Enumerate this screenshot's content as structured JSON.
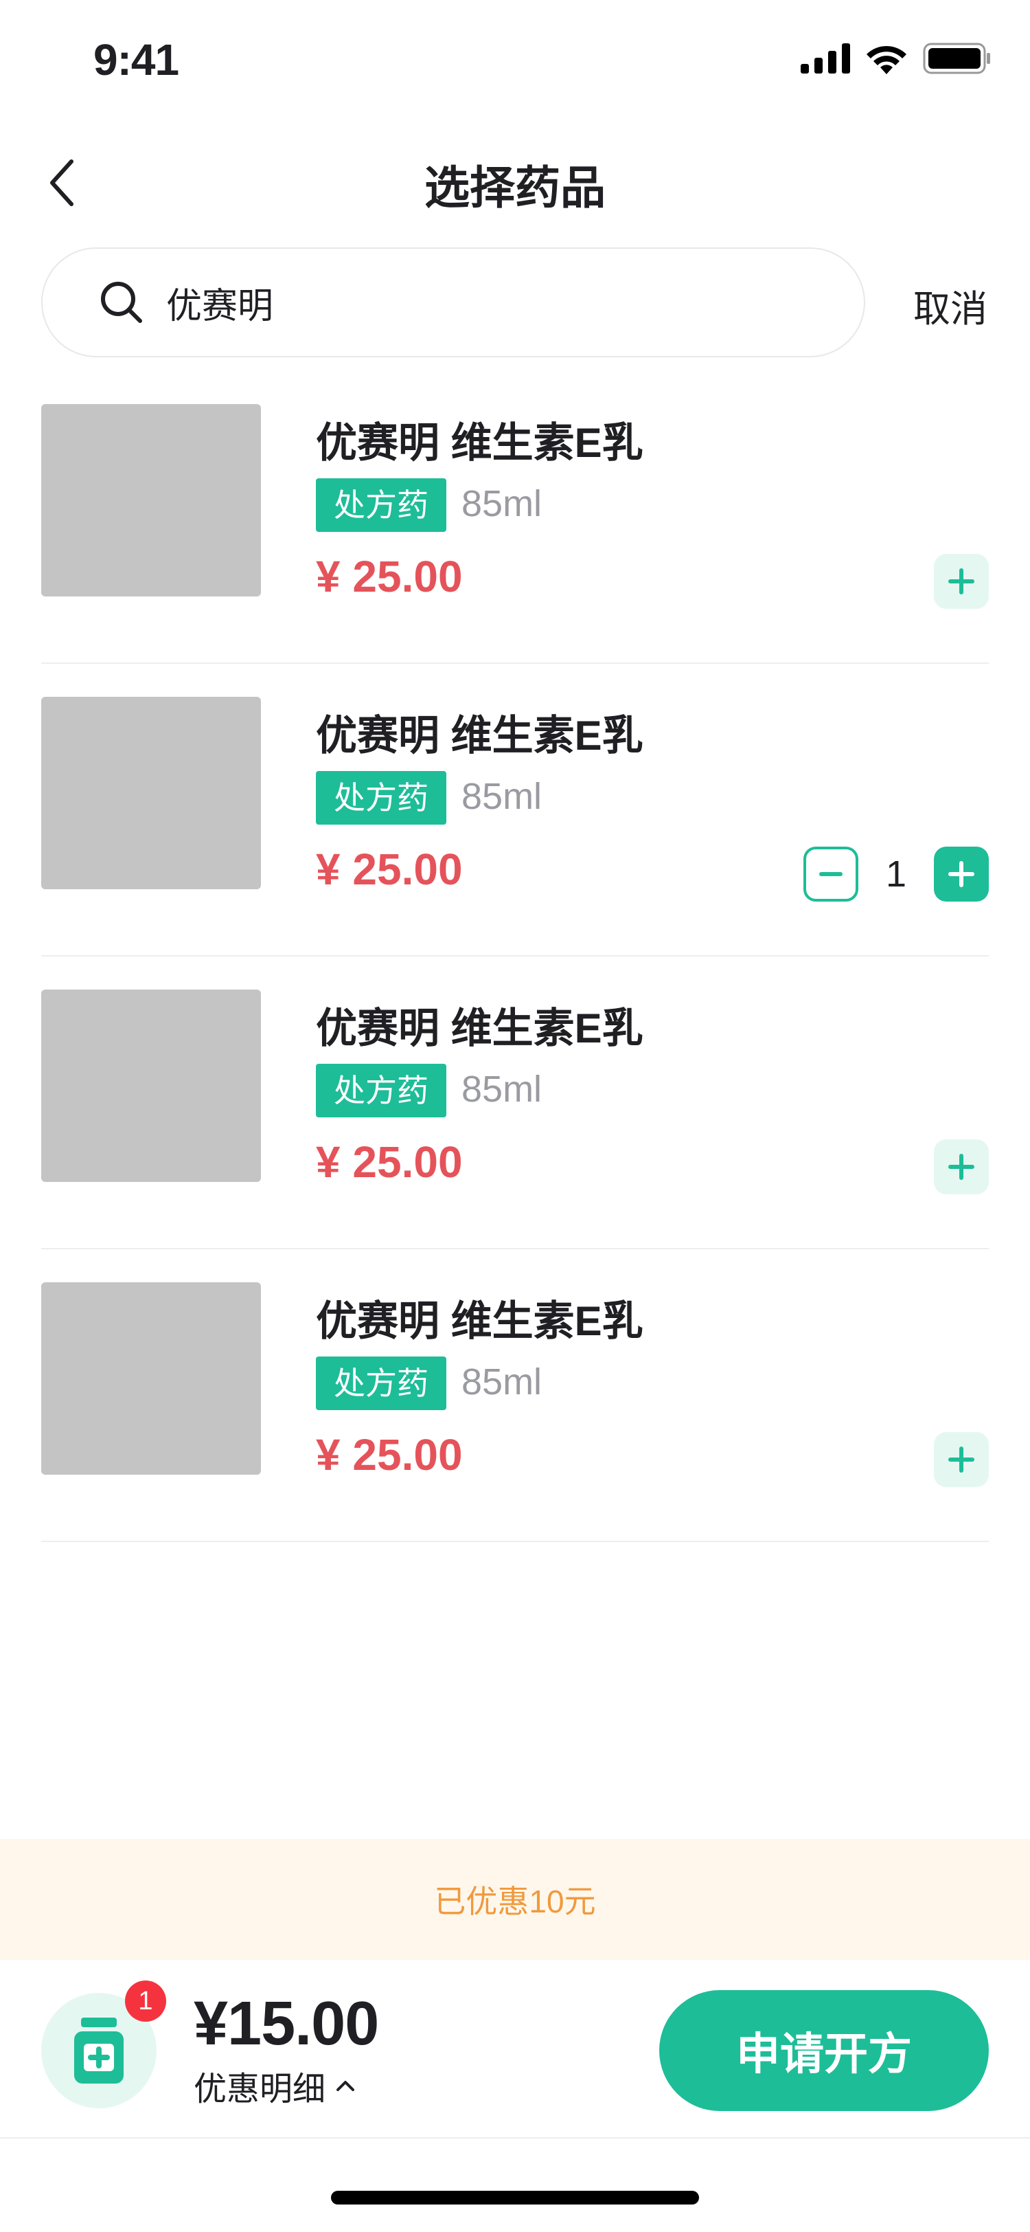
{
  "status_bar": {
    "time": "9:41"
  },
  "nav": {
    "title": "选择药品"
  },
  "search": {
    "value": "优赛明",
    "cancel_label": "取消"
  },
  "products": [
    {
      "name": "优赛明 维生素E乳",
      "badge": "处方药",
      "spec": "85ml",
      "price": "¥ 25.00",
      "quantity": 0
    },
    {
      "name": "优赛明 维生素E乳",
      "badge": "处方药",
      "spec": "85ml",
      "price": "¥ 25.00",
      "quantity": "1"
    },
    {
      "name": "优赛明 维生素E乳",
      "badge": "处方药",
      "spec": "85ml",
      "price": "¥ 25.00",
      "quantity": 0
    },
    {
      "name": "优赛明 维生素E乳",
      "badge": "处方药",
      "spec": "85ml",
      "price": "¥ 25.00",
      "quantity": 0
    }
  ],
  "discount_banner": {
    "text": "已优惠10元"
  },
  "checkout": {
    "cart_count": "1",
    "total": "¥15.00",
    "detail_label": "优惠明细",
    "submit_label": "申请开方"
  },
  "colors": {
    "accent": "#1dbd98",
    "price": "#e5535a",
    "badge_red": "#f5333f",
    "banner_bg": "#fff7ec",
    "banner_text": "#f09a3e"
  }
}
